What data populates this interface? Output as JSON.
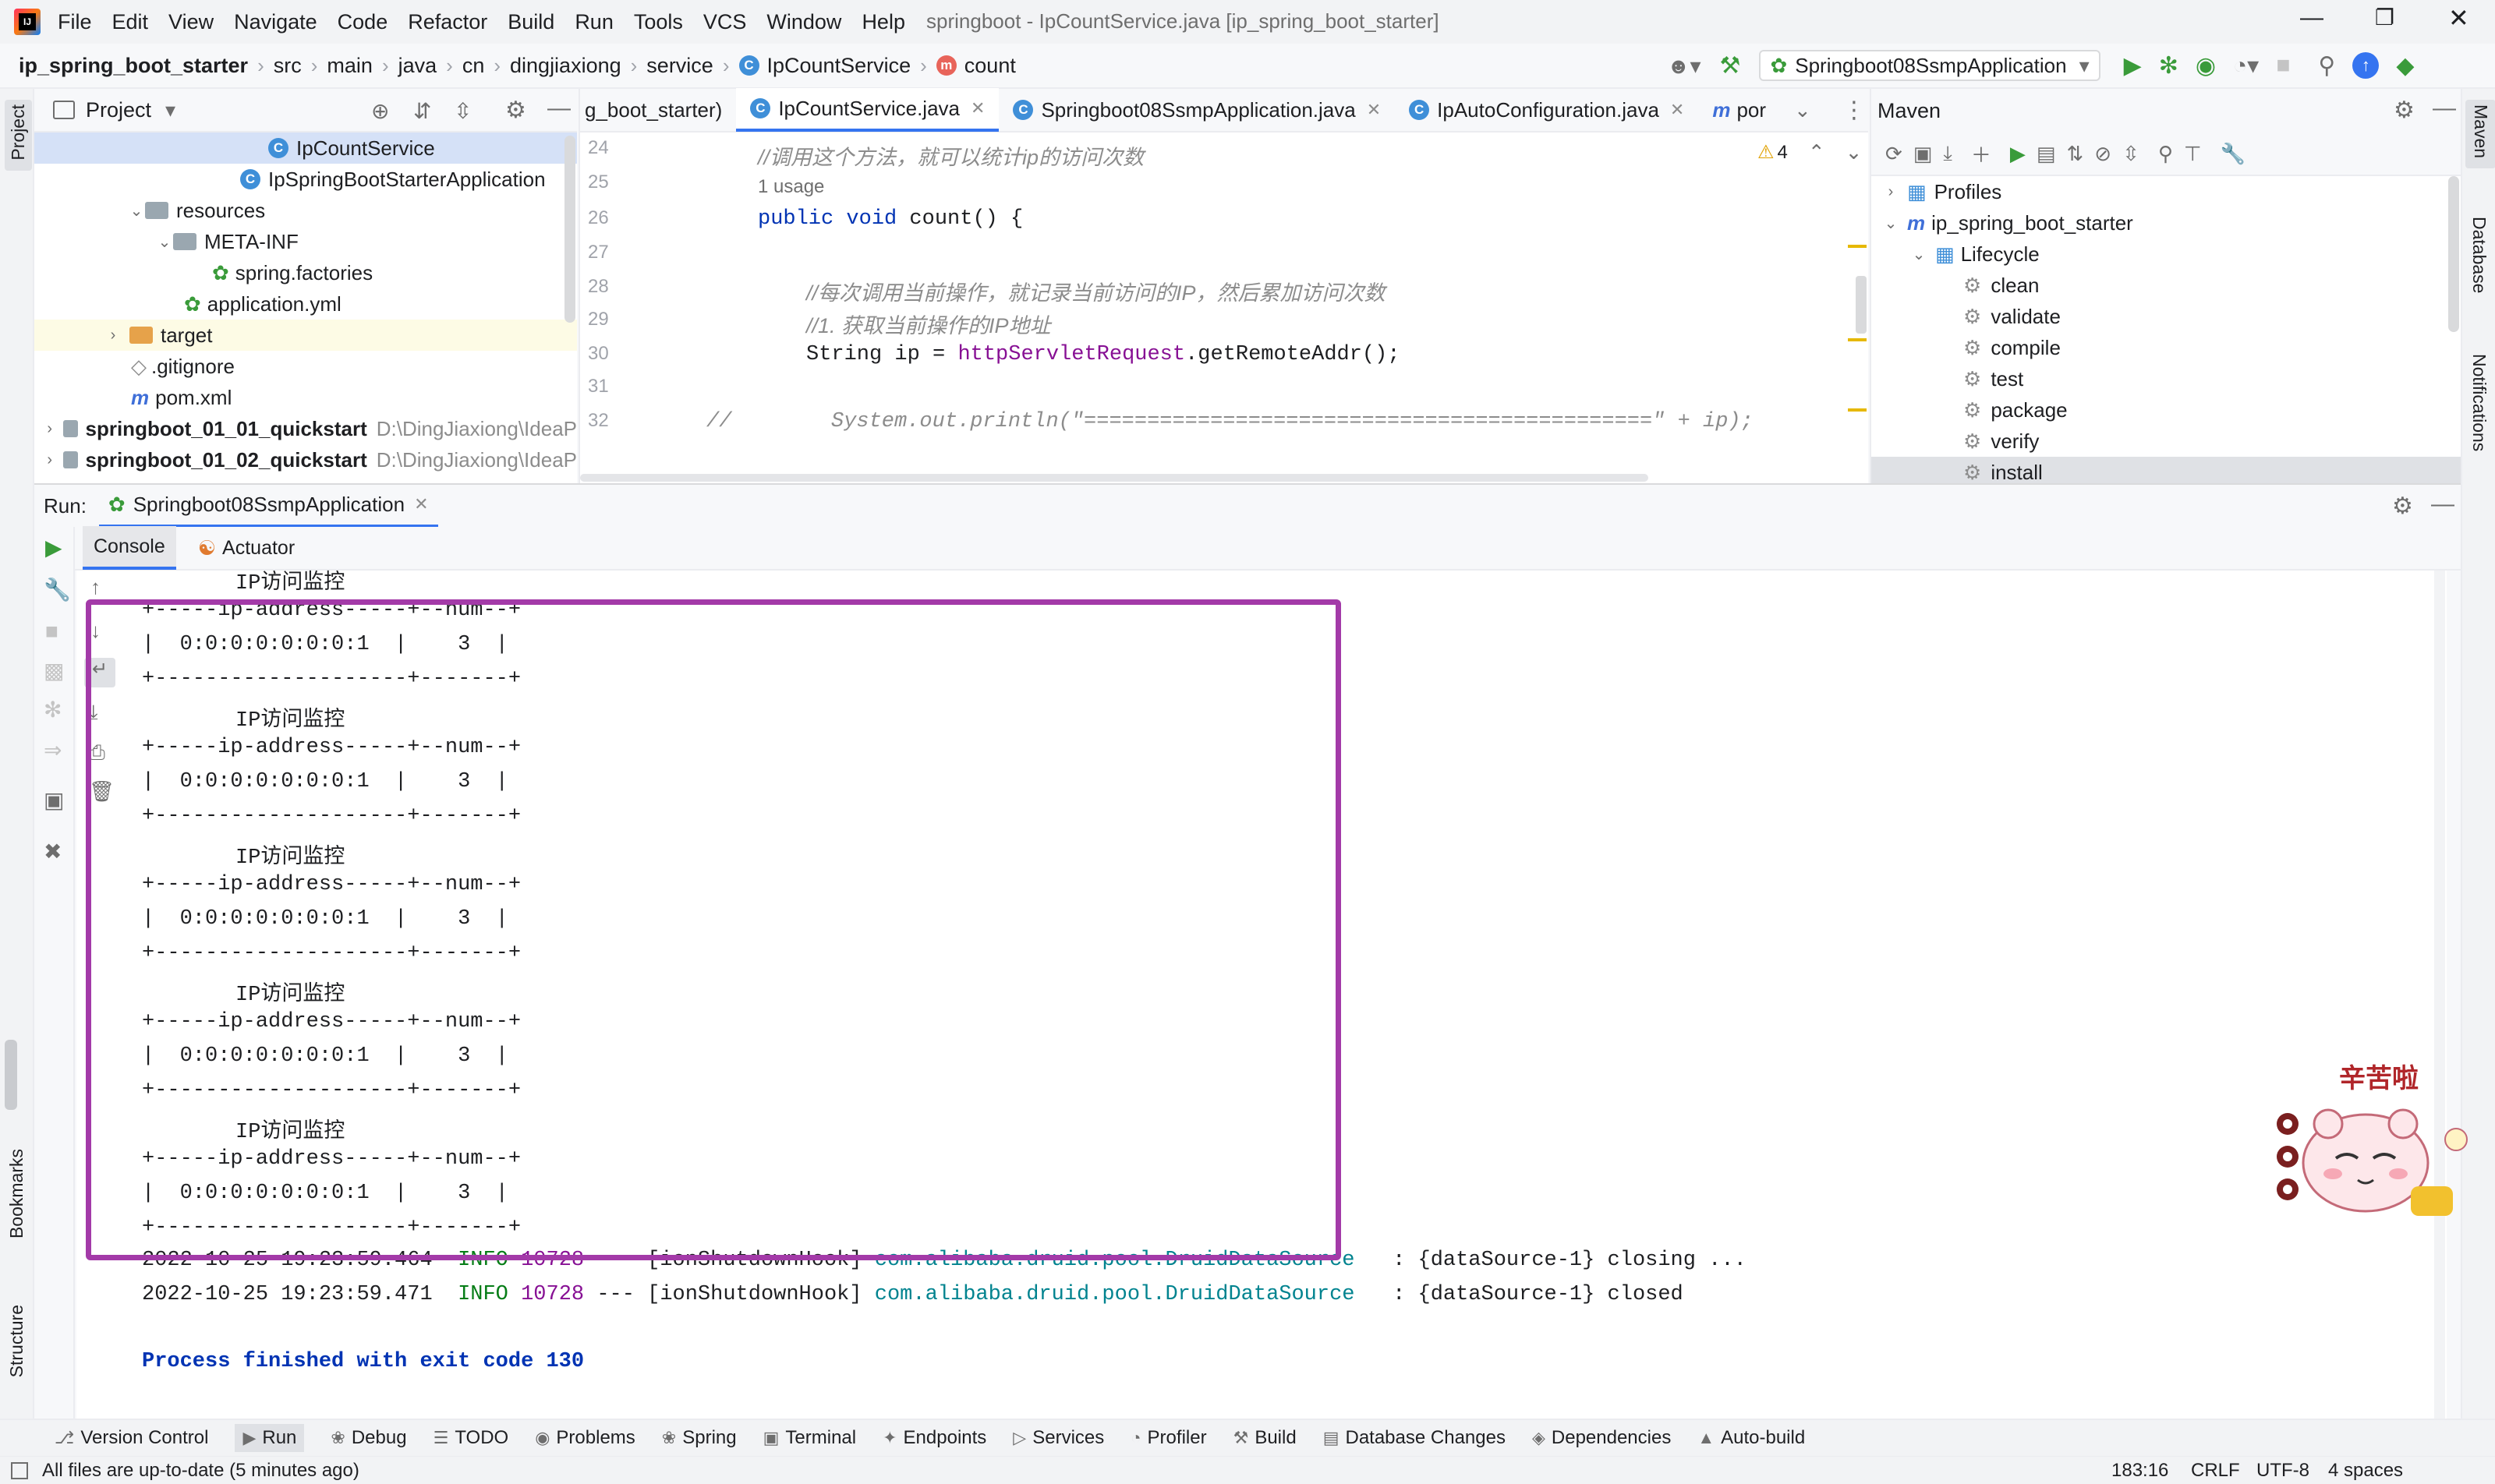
{
  "menu": {
    "items": [
      "File",
      "Edit",
      "View",
      "Navigate",
      "Code",
      "Refactor",
      "Build",
      "Run",
      "Tools",
      "VCS",
      "Window",
      "Help"
    ],
    "window_title": "springboot - IpCountService.java [ip_spring_boot_starter]"
  },
  "nav": {
    "crumbs": [
      "ip_spring_boot_starter",
      "src",
      "main",
      "java",
      "cn",
      "dingjiaxiong",
      "service",
      "IpCountService",
      "count"
    ],
    "run_config": "Springboot08SsmpApplication"
  },
  "project": {
    "title": "Project",
    "rows": [
      {
        "label": "IpCountService",
        "indent": 0,
        "selected": true
      },
      {
        "label": "IpSpringBootStarterApplication",
        "indent": 0
      },
      {
        "label": "resources",
        "indent": 0
      },
      {
        "label": "META-INF",
        "indent": 1
      },
      {
        "label": "spring.factories",
        "indent": 2
      },
      {
        "label": "application.yml",
        "indent": 1
      },
      {
        "label": "target",
        "indent": 0
      },
      {
        "label": ".gitignore",
        "indent": 0
      },
      {
        "label": "pom.xml",
        "indent": 0
      },
      {
        "label": "springboot_01_01_quickstart",
        "path": "D:\\DingJiaxiong\\IdeaP"
      },
      {
        "label": "springboot_01_02_quickstart",
        "path": "D:\\DingJiaxiong\\IdeaP"
      }
    ]
  },
  "editor": {
    "tabs": [
      "g_boot_starter)",
      "IpCountService.java",
      "Springboot08SsmpApplication.java",
      "IpAutoConfiguration.java",
      "por"
    ],
    "warnings": "4",
    "line_numbers": [
      "24",
      "25",
      "26",
      "27",
      "28",
      "29",
      "30",
      "31",
      "32"
    ],
    "code": {
      "comment1": "//调用这个方法，就可以统计ip的访问次数",
      "usage": "1 usage",
      "sig_kw": "public void",
      "sig_rest": " count() {",
      "comment2": "//每次调用当前操作，就记录当前访问的IP，然后累加访问次数",
      "comment3": "//1. 获取当前操作的IP地址",
      "l30_type": "String ip = ",
      "l30_field": "httpServletRequest",
      "l30_rest": ".getRemoteAddr();",
      "l32_prefix": "//",
      "l32_a": "System.out.println(",
      "l32_str": "\"=============================================\"",
      "l32_b": " + ip);"
    }
  },
  "maven": {
    "title": "Maven",
    "profiles": "Profiles",
    "project": "ip_spring_boot_starter",
    "lifecycle": "Lifecycle",
    "goals": [
      "clean",
      "validate",
      "compile",
      "test",
      "package",
      "verify",
      "install"
    ],
    "selected_goal": "install"
  },
  "run": {
    "label": "Run:",
    "config_tab": "Springboot08SsmpApplication",
    "tabs": [
      "Console",
      "Actuator"
    ],
    "monitor_title": "IP访问监控",
    "border_line": "+-----ip-address-----+--num--+",
    "row_line": "|  0:0:0:0:0:0:0:1  |    3  |",
    "footer_line": "+--------------------+-------+",
    "log1": {
      "ts": "2022-10-25 19:23:59.464",
      "level": "INFO",
      "pid": "10728",
      "thread": "--- [ionShutdownHook]",
      "cls": "com.alibaba.druid.pool.DruidDataSource",
      "msg": "  : {dataSource-1} closing ..."
    },
    "log2": {
      "ts": "2022-10-25 19:23:59.471",
      "level": "INFO",
      "pid": "10728",
      "thread": "--- [ionShutdownHook]",
      "cls": "com.alibaba.druid.pool.DruidDataSource",
      "msg": "  : {dataSource-1} closed"
    },
    "exit": "Process finished with exit code 130",
    "sticker_text": "辛苦啦"
  },
  "bottom_tools": [
    "Version Control",
    "Run",
    "Debug",
    "TODO",
    "Problems",
    "Spring",
    "Terminal",
    "Endpoints",
    "Services",
    "Profiler",
    "Build",
    "Database Changes",
    "Dependencies",
    "Auto-build"
  ],
  "left_stripe": [
    "Project",
    "Bookmarks",
    "Structure"
  ],
  "right_stripe": [
    "Maven",
    "Database",
    "Notifications"
  ],
  "status": {
    "message": "All files are up-to-date (5 minutes ago)",
    "position": "183:16",
    "line_sep": "CRLF",
    "encoding": "UTF-8",
    "indent": "4 spaces"
  },
  "colors": {
    "accent": "#3574f0",
    "highlight_box": "#a33aa8",
    "run_green": "#3a9b3a"
  }
}
